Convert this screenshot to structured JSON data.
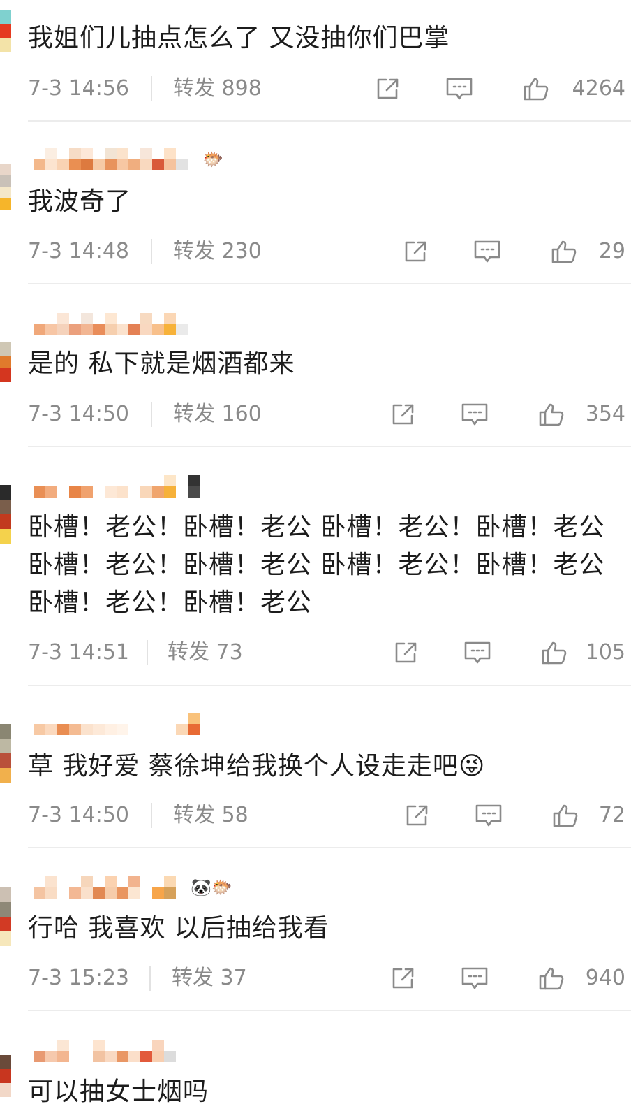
{
  "comments": [
    {
      "username": "",
      "text": "我姐们儿抽点怎么了 又没抽你们巴掌",
      "time": "7-3 14:56",
      "repost_label": "转发",
      "repost_count": "898",
      "likes": "4264",
      "emoji": ""
    },
    {
      "username": "",
      "text": "我波奇了",
      "time": "7-3 14:48",
      "repost_label": "转发",
      "repost_count": "230",
      "likes": "29",
      "emoji": "🐡"
    },
    {
      "username": "",
      "text": "是的 私下就是烟酒都来",
      "time": "7-3 14:50",
      "repost_label": "转发",
      "repost_count": "160",
      "likes": "354",
      "emoji": ""
    },
    {
      "username": "",
      "text": "卧槽！老公！卧槽！老公 卧槽！老公！卧槽！老公\n卧槽！老公！卧槽！老公 卧槽！老公！卧槽！老公\n卧槽！老公！卧槽！老公",
      "time": "7-3 14:51",
      "repost_label": "转发",
      "repost_count": "73",
      "likes": "105",
      "emoji": ""
    },
    {
      "username": "",
      "text": "草 我好爱 蔡徐坤给我换个人设走走吧😜",
      "time": "7-3 14:50",
      "repost_label": "转发",
      "repost_count": "58",
      "likes": "72",
      "emoji": ""
    },
    {
      "username": "",
      "text": "行哈 我喜欢 以后抽给我看",
      "time": "7-3 15:23",
      "repost_label": "转发",
      "repost_count": "37",
      "likes": "940",
      "emoji": "🐼🐡"
    },
    {
      "username": "",
      "text": "可以抽女士烟吗",
      "time": "",
      "repost_label": "",
      "repost_count": "",
      "likes": "",
      "emoji": ""
    }
  ],
  "icons": {
    "share": "share-icon",
    "comment": "comment-icon",
    "like": "thumbs-up-icon"
  },
  "colors": {
    "text": "#1c1c1c",
    "meta": "#8a8a8a",
    "divider": "#ececec"
  }
}
